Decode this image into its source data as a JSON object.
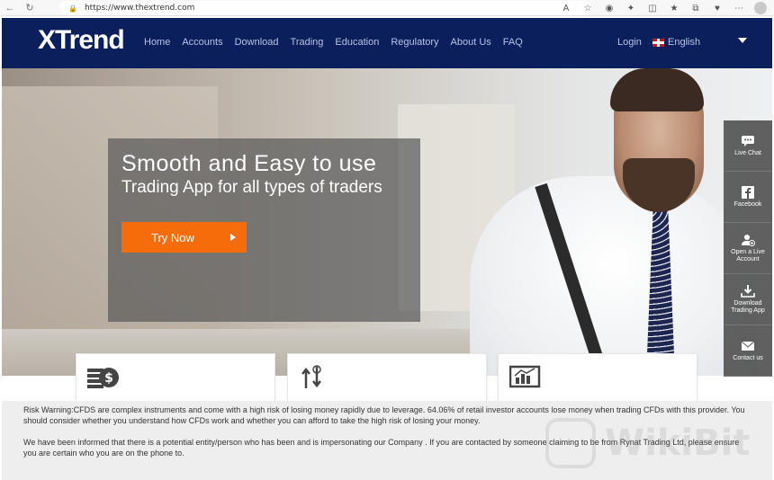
{
  "browser": {
    "url": "https://www.thextrend.com"
  },
  "header": {
    "logo": "XTrend",
    "nav": [
      "Home",
      "Accounts",
      "Download",
      "Trading",
      "Education",
      "Regulatory",
      "About Us",
      "FAQ"
    ],
    "login": "Login",
    "language": "English"
  },
  "hero": {
    "line1": "Smooth and Easy to use",
    "line2": "Trading App for all types of traders",
    "cta": "Try Now"
  },
  "side_widget": [
    {
      "label": "Live Chat",
      "icon": "chat-icon"
    },
    {
      "label": "Facebook",
      "icon": "facebook-icon"
    },
    {
      "label": "Open a Live Account",
      "icon": "add-user-icon"
    },
    {
      "label": "Download Trading App",
      "icon": "download-icon"
    },
    {
      "label": "Contact us",
      "icon": "mail-icon"
    }
  ],
  "features": [
    {
      "icon": "coins-dollar-icon"
    },
    {
      "icon": "transfer-arrows-icon"
    },
    {
      "icon": "chart-screen-icon"
    }
  ],
  "footer": {
    "risk_warning": "Risk Warning:CFDS are complex instruments and come with a high risk of losing money rapidly due to leverage. 64.06% of retail investor accounts lose money when trading CFDs with this provider. You should consider whether you understand how CFDs work and whether you can afford to take the high risk of losing your money.",
    "impersonation_notice": "We have been informed that there is a potential entity/person who has been and is impersonating our Company . If you are contacted by someone claiming to be from Rynat Trading Ltd, please ensure you are certain who you are on the phone to.",
    "watermark": "WikiBit"
  },
  "colors": {
    "header_bg": "#0a1f5c",
    "cta": "#f46d0a",
    "nav_text": "#b8c4e6"
  }
}
